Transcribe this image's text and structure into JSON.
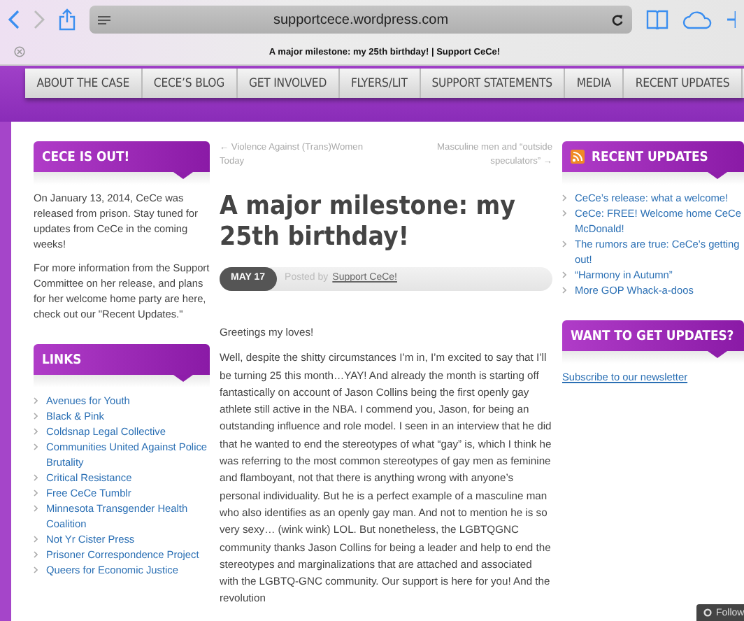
{
  "browser": {
    "url": "supportcece.wordpress.com",
    "tab_title": "A major milestone: my 25th birthday! | Support CeCe!"
  },
  "nav": [
    "ABOUT THE CASE",
    "CECE’S BLOG",
    "GET INVOLVED",
    "FLYERS/LIT",
    "SUPPORT STATEMENTS",
    "MEDIA",
    "RECENT UPDATES"
  ],
  "left_sidebar": [
    {
      "kind": "text",
      "title": "CECE IS OUT!",
      "paragraphs": [
        "On January 13, 2014, CeCe was released from prison. Stay tuned for updates from CeCe in the coming weeks!",
        "For more information from the Support Committee on her release, and plans for her welcome home party are here, check out our \"Recent Updates.\""
      ]
    },
    {
      "kind": "links",
      "title": "LINKS",
      "items": [
        "Avenues for Youth",
        "Black & Pink",
        "Coldsnap Legal Collective",
        "Communities United Against Police Brutality",
        "Critical Resistance",
        "Free CeCe Tumblr",
        "Minnesota Transgender Health Coalition",
        "Not Yr Cister Press",
        "Prisoner Correspondence Project",
        "Queers for Economic Justice"
      ]
    }
  ],
  "post": {
    "prev": "← Violence Against (Trans)Women Today",
    "next": "Masculine men and “outside speculators” →",
    "title": "A major milestone: my 25th birthday!",
    "date": "MAY 17",
    "posted_by": "Posted by",
    "author": "Support CeCe!",
    "paragraphs": [
      "Greetings my loves!",
      "Well, despite the shitty circumstances I’m in, I’m excited to say that I’ll be turning 25 this month…YAY! And already the month is starting off fantastically on account of Jason Collins being the first openly gay athlete still active in the NBA. I commend you, Jason, for being an outstanding influence and role model. I seen in an interview that he did that he wanted to end the stereotypes of what “gay” is, which I think he was referring to the most common stereotypes of gay men as feminine and flamboyant, not that there is anything wrong with anyone’s personal individuality. But he is a perfect example of a masculine man who also identifies as an openly gay man. And not to mention he is so very sexy… (wink wink) LOL. But nonetheless, the LGBTQGNC community thanks Jason Collins for being a leader and help to end the stereotypes and marginalizations that are attached and associated with the LGBTQ-GNC community. Our support is here for you! And the revolution"
    ]
  },
  "right_sidebar": [
    {
      "kind": "feed",
      "title": "RECENT UPDATES",
      "items": [
        "CeCe’s release: what a welcome!",
        "CeCe: FREE! Welcome home CeCe McDonald!",
        "The rumors are true: CeCe’s getting out!",
        "“Harmony in Autumn”",
        "More GOP Whack-a-doos"
      ]
    },
    {
      "kind": "link",
      "title": "WANT TO GET UPDATES?",
      "link": "Subscribe to our newsletter"
    }
  ],
  "follow_button": "Follow"
}
